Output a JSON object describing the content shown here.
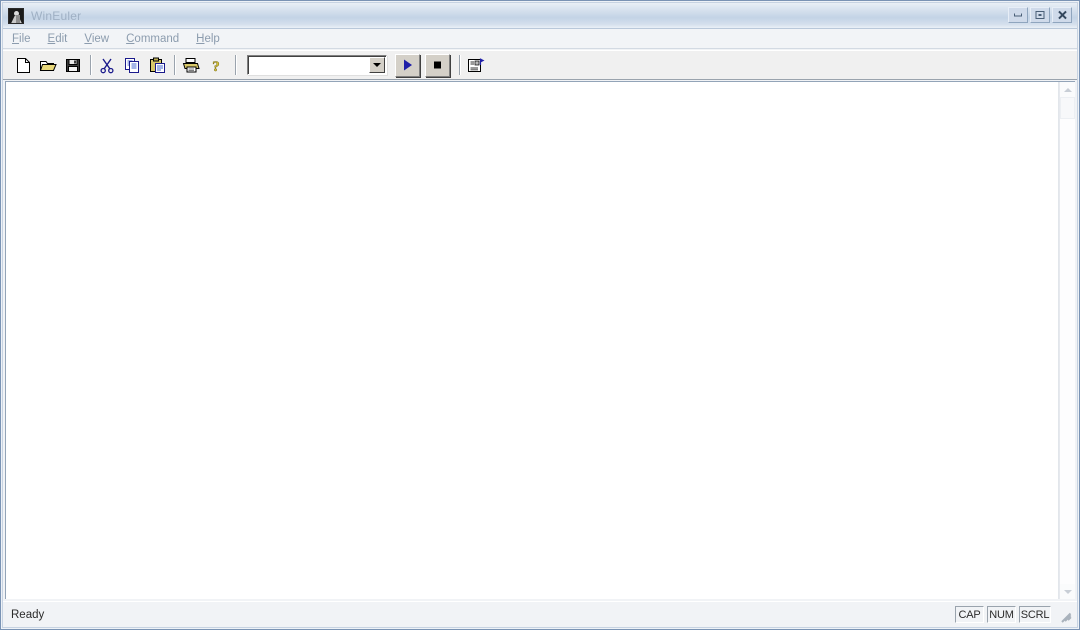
{
  "window": {
    "title": "WinEuler",
    "icon": "euler-portrait-icon",
    "buttons": [
      {
        "name": "minimize",
        "label": "Minimize"
      },
      {
        "name": "maximize",
        "label": "Maximize"
      },
      {
        "name": "close",
        "label": "Close"
      }
    ]
  },
  "menubar": {
    "items": [
      {
        "label": "File",
        "mnemonic": "F"
      },
      {
        "label": "Edit",
        "mnemonic": "E"
      },
      {
        "label": "View",
        "mnemonic": "V"
      },
      {
        "label": "Command",
        "mnemonic": "C"
      },
      {
        "label": "Help",
        "mnemonic": "H"
      }
    ]
  },
  "toolbar": {
    "buttons": [
      {
        "name": "new-document",
        "icon": "new-document-icon",
        "tooltip": "New"
      },
      {
        "name": "open-document",
        "icon": "open-folder-icon",
        "tooltip": "Open"
      },
      {
        "name": "save-document",
        "icon": "floppy-disk-icon",
        "tooltip": "Save"
      },
      {
        "name": "cut",
        "icon": "scissors-icon",
        "tooltip": "Cut"
      },
      {
        "name": "copy",
        "icon": "copy-icon",
        "tooltip": "Copy"
      },
      {
        "name": "paste",
        "icon": "clipboard-icon",
        "tooltip": "Paste"
      },
      {
        "name": "print",
        "icon": "printer-icon",
        "tooltip": "Print"
      },
      {
        "name": "help",
        "icon": "question-mark-icon",
        "tooltip": "Help"
      },
      {
        "name": "run",
        "icon": "play-triangle-icon",
        "tooltip": "Run"
      },
      {
        "name": "stop",
        "icon": "stop-square-icon",
        "tooltip": "Stop"
      },
      {
        "name": "properties",
        "icon": "document-properties-icon",
        "tooltip": "Properties"
      }
    ],
    "command_combo": {
      "value": "",
      "placeholder": ""
    }
  },
  "client": {
    "content": "",
    "scrollbar": {
      "orientation": "vertical",
      "up_arrow": "scroll-up-icon",
      "down_arrow": "scroll-down-icon"
    }
  },
  "statusbar": {
    "message": "Ready",
    "panes": [
      {
        "label": "CAP"
      },
      {
        "label": "NUM"
      },
      {
        "label": "SCRL"
      }
    ]
  },
  "colors": {
    "title_gradient_top": "#e9eff6",
    "title_gradient_mid": "#c3d3e6",
    "title_text": "#9fb0c4",
    "toolbar_face": "#f0f0f0",
    "client_bg": "#ffffff",
    "run_icon": "#1f1fa8",
    "stop_icon": "#000000",
    "window_border": "#7a93b4"
  }
}
